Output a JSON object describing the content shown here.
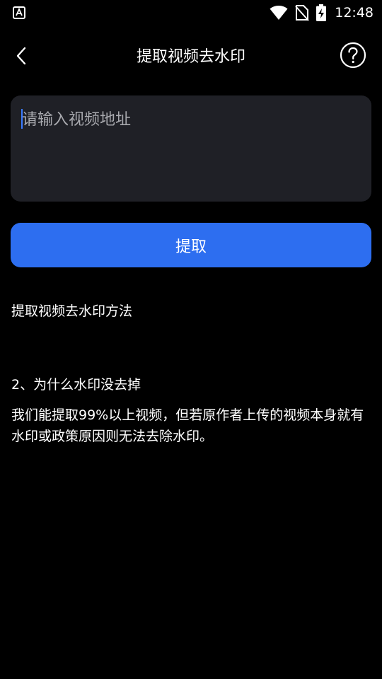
{
  "status_bar": {
    "time": "12:48",
    "icons": [
      "app-notification-icon",
      "wifi-icon",
      "no-sim-icon",
      "battery-charging-icon"
    ]
  },
  "header": {
    "title": "提取视频去水印",
    "back_icon": "chevron-left-icon",
    "help_icon": "question-circle-icon"
  },
  "url_input": {
    "placeholder": "请输入视频地址",
    "value": ""
  },
  "extract_button": {
    "label": "提取"
  },
  "help_section": {
    "title": "提取视频去水印方法",
    "faq": [
      {
        "question": "2、为什么水印没去掉",
        "answer": "我们能提取99%以上视频，但若原作者上传的视频本身就有水印或政策原因则无法去除水印。"
      }
    ]
  },
  "colors": {
    "background": "#000000",
    "input_background": "#1f2026",
    "accent": "#2d6ef0",
    "placeholder": "#a8a9ae"
  }
}
